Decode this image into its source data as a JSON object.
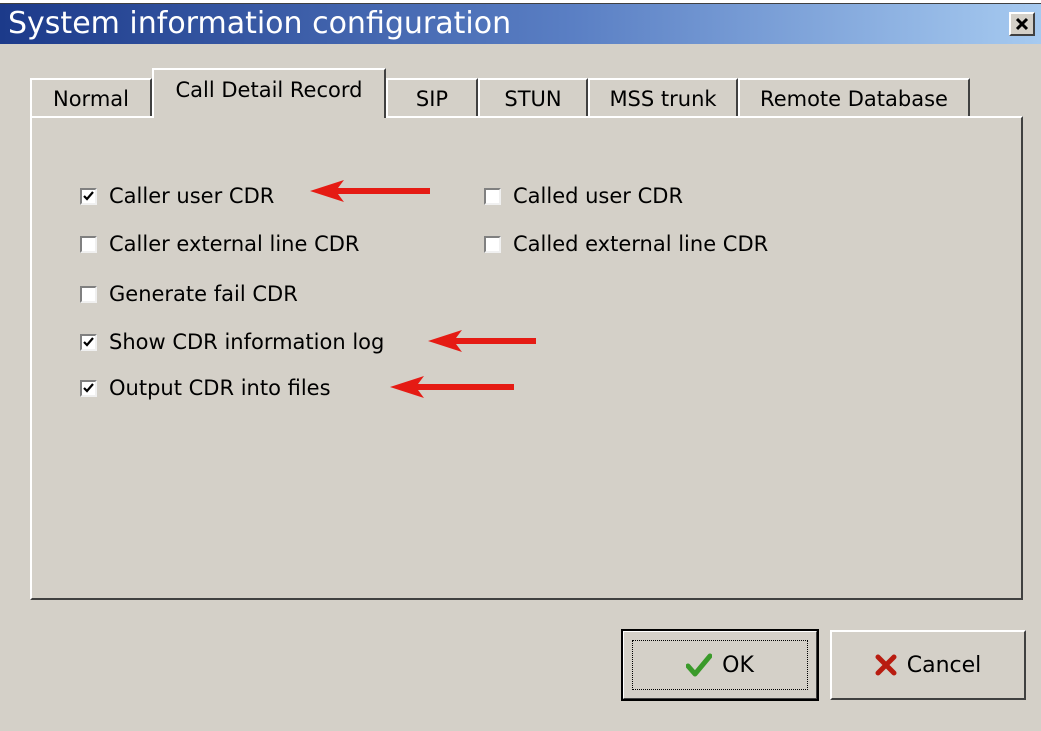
{
  "window": {
    "title": "System information configuration"
  },
  "tabs": [
    {
      "label": "Normal"
    },
    {
      "label": "Call Detail Record"
    },
    {
      "label": "SIP"
    },
    {
      "label": "STUN"
    },
    {
      "label": "MSS trunk"
    },
    {
      "label": "Remote Database"
    }
  ],
  "active_tab": "Call Detail Record",
  "options": {
    "caller_user_cdr": {
      "label": "Caller user CDR",
      "checked": true
    },
    "called_user_cdr": {
      "label": "Called user CDR",
      "checked": false
    },
    "caller_external_line_cdr": {
      "label": "Caller external line CDR",
      "checked": false
    },
    "called_external_line_cdr": {
      "label": "Called external line CDR",
      "checked": false
    },
    "generate_fail_cdr": {
      "label": "Generate fail CDR",
      "checked": false
    },
    "show_cdr_information_log": {
      "label": "Show CDR information log",
      "checked": true
    },
    "output_cdr_into_files": {
      "label": "Output CDR into files",
      "checked": true
    }
  },
  "buttons": {
    "ok": {
      "label": "OK",
      "icon": "checkmark-icon"
    },
    "cancel": {
      "label": "Cancel",
      "icon": "x-icon"
    }
  },
  "colors": {
    "annotation_arrow": "#e51b14",
    "titlebar_start": "#1c3a8a",
    "titlebar_end": "#a6caf0",
    "ok_check": "#3a9a2a",
    "cancel_x": "#b81c10"
  }
}
